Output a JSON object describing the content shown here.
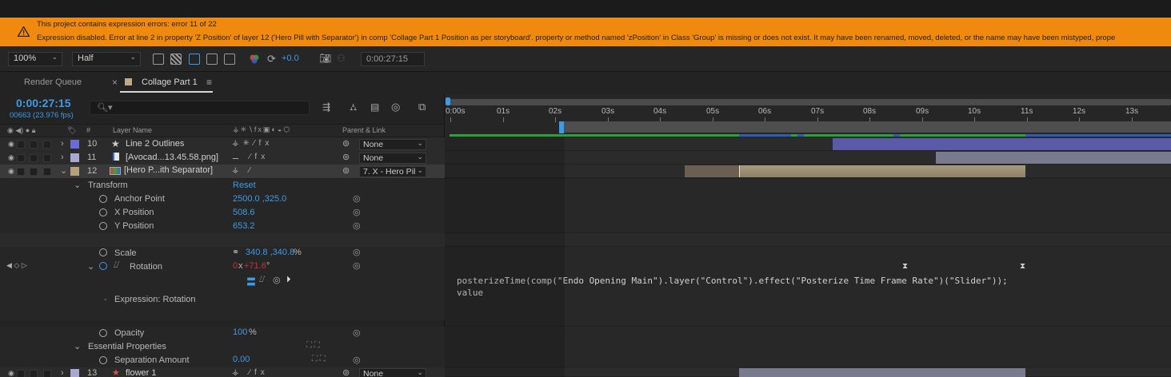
{
  "error_banner": {
    "line1": "This project contains expression errors: error 11 of 22",
    "line2": "Expression disabled. Error at line 2 in property 'Z Position' of layer 12 ('Hero Pill with Separator') in comp 'Collage Part 1 Position as per storyboard'.  property or method named 'zPosition' in Class 'Group' is missing or does not exist. It may have been renamed, moved, deleted, or the name may have been mistyped, prope"
  },
  "viewer_toolbar": {
    "zoom": "100%",
    "resolution": "Half",
    "exposure": "+0.0",
    "timecode": "0:00:27:15"
  },
  "panel_tabs": {
    "render_queue": "Render Queue",
    "close_glyph": "×",
    "comp_tab": "Collage Part 1",
    "menu_glyph": "≡"
  },
  "timeline": {
    "current_time": "0:00:27:15",
    "frame_info": "00663 (23.976 fps)",
    "search_placeholder": "🔍︎▾",
    "columns": {
      "hash": "#",
      "layer_name": "Layer Name",
      "parent_link": "Parent & Link"
    },
    "ruler_ticks": [
      "0:00s",
      "01s",
      "02s",
      "03s",
      "04s",
      "05s",
      "06s",
      "07s",
      "08s",
      "09s",
      "10s",
      "11s",
      "12s",
      "13s"
    ],
    "layers": [
      {
        "num": "10",
        "name": "Line 2 Outlines",
        "parent": "None",
        "color": "#6b6bd8",
        "icon": "star-icon"
      },
      {
        "num": "11",
        "name": "[Avocad...13.45.58.png]",
        "parent": "None",
        "color": "#a8a8d0",
        "icon": "file-icon"
      },
      {
        "num": "12",
        "name": "[Hero P...ith Separator]",
        "parent": "7. X - Hero Pil",
        "color": "#b8a07a",
        "icon": "precomp-icon"
      },
      {
        "num": "13",
        "name": "flower 1",
        "parent": "None",
        "color": "#a8a8d0",
        "icon": "shape-icon"
      }
    ],
    "transform": {
      "label": "Transform",
      "reset": "Reset",
      "anchor_point": {
        "label": "Anchor Point",
        "value": "2500.0 ,325.0"
      },
      "x_position": {
        "label": "X Position",
        "value": "508.6"
      },
      "y_position": {
        "label": "Y Position",
        "value": "653.2"
      },
      "scale": {
        "label": "Scale",
        "value": "340.8 ,340.8",
        "unit": "%"
      },
      "rotation": {
        "label": "Rotation",
        "revs": "0",
        "x": "x",
        "degrees": "+71.6",
        "unit": "°"
      },
      "expression_label": "Expression: Rotation",
      "opacity": {
        "label": "Opacity",
        "value": "100",
        "unit": "%"
      }
    },
    "essential": {
      "label": "Essential Properties",
      "separation": {
        "label": "Separation Amount",
        "value": "0.00"
      }
    },
    "expression_code": "posterizeTime(comp(\"Endo Opening Main\").layer(\"Control\").effect(\"Posterize Time Frame Rate\")(\"Slider\"));\nvalue"
  },
  "colors": {
    "accent": "#3d9ae8",
    "error_banner": "#f08a0e",
    "playhead_range": "#27a33a"
  }
}
